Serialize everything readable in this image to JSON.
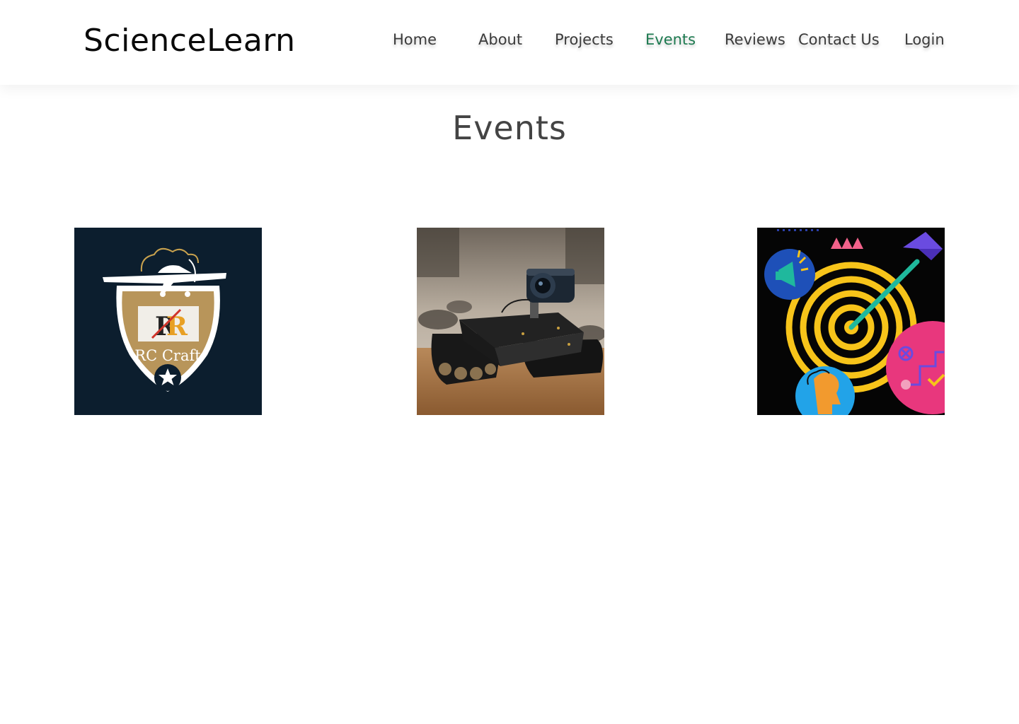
{
  "header": {
    "brand": "ScienceLearn",
    "nav": [
      {
        "label": "Home",
        "active": false
      },
      {
        "label": "About",
        "active": false
      },
      {
        "label": "Projects",
        "active": false
      },
      {
        "label": "Events",
        "active": true
      },
      {
        "label": "Reviews",
        "active": false
      },
      {
        "label": "Contact Us",
        "active": false
      },
      {
        "label": "Login",
        "active": false
      }
    ],
    "active_color": "#1d7a50"
  },
  "events": {
    "title": "Events",
    "cards": [
      {
        "icon": "rc-craft-badge-icon",
        "logo_text": "RC Craft",
        "bg_color": "#0c1e2e"
      },
      {
        "icon": "robot-rover-photo",
        "bg_color": "#b8a890"
      },
      {
        "icon": "target-dart-icon",
        "bg_color": "#050505"
      }
    ]
  }
}
